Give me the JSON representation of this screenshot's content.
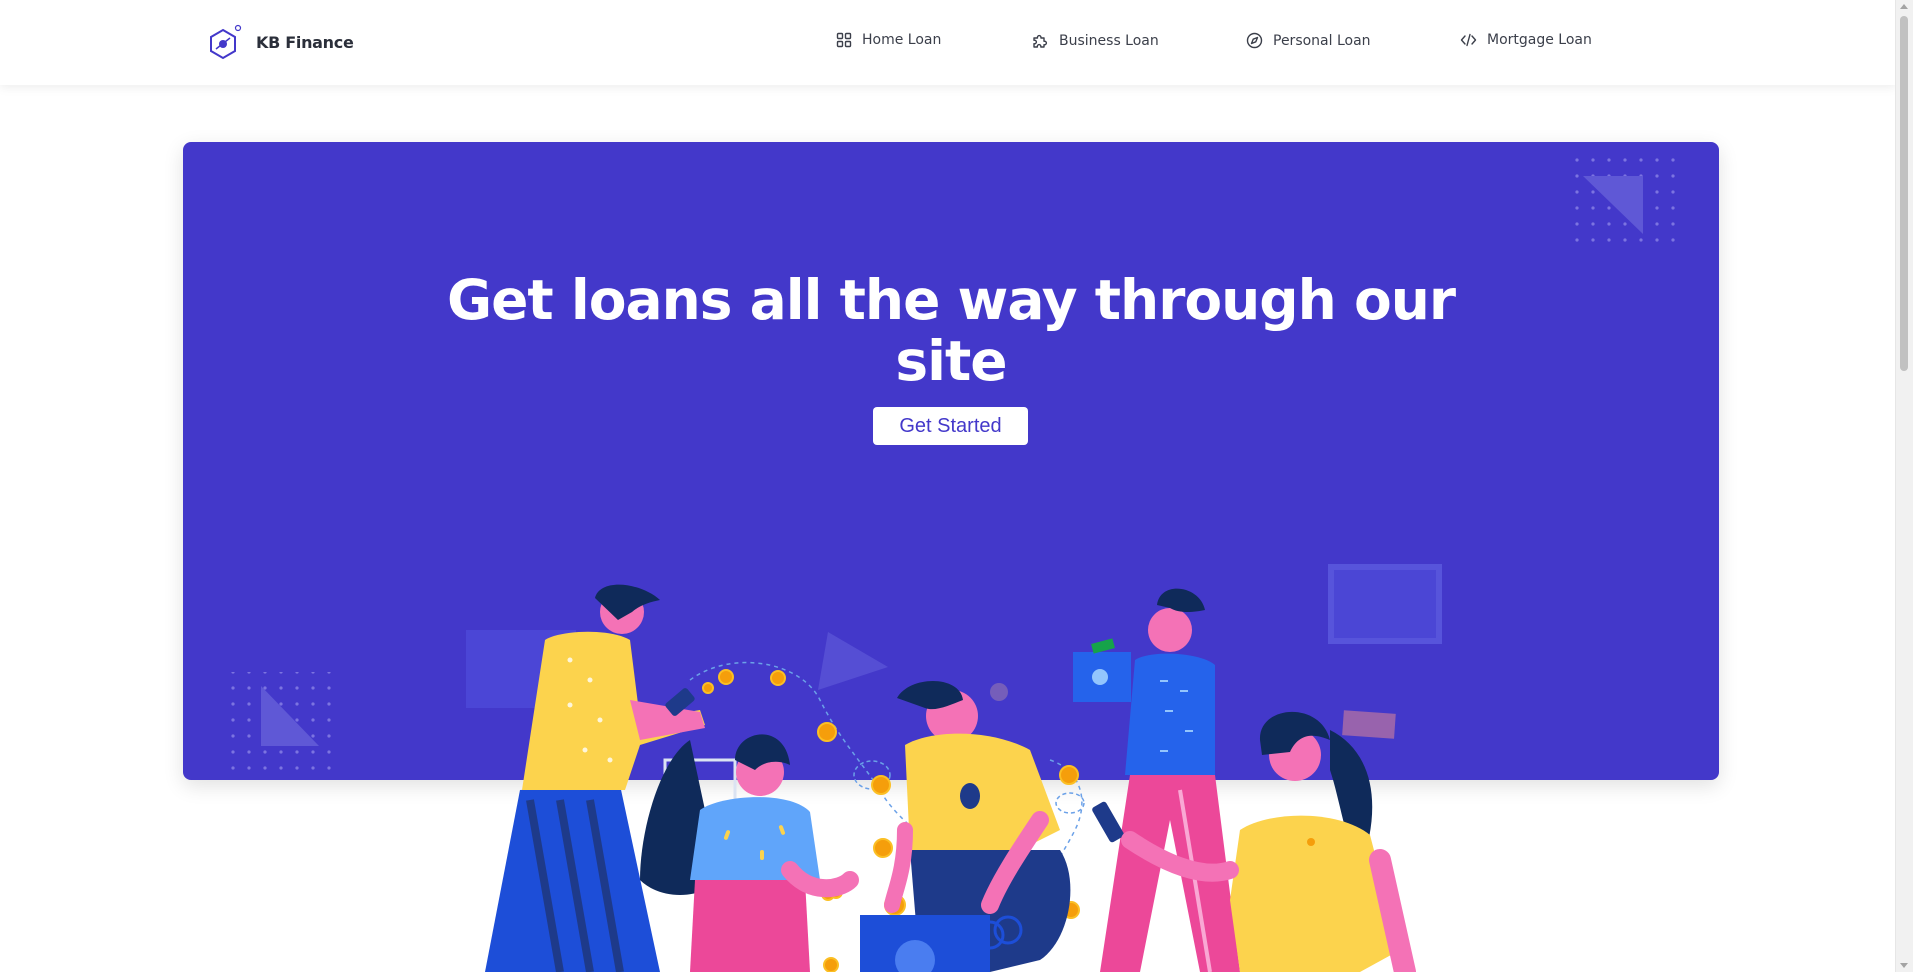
{
  "brand": {
    "name": "KB Finance"
  },
  "nav": {
    "items": [
      {
        "label": "Home Loan",
        "icon": "grid-icon"
      },
      {
        "label": "Business Loan",
        "icon": "puzzle-icon"
      },
      {
        "label": "Personal Loan",
        "icon": "compass-icon"
      },
      {
        "label": "Mortgage Loan",
        "icon": "code-icon"
      }
    ]
  },
  "hero": {
    "title_line1": "Get loans all the way through our",
    "title_line2": "site",
    "cta_label": "Get Started"
  },
  "colors": {
    "accent": "#4338ca",
    "navbar_bg": "#ffffff",
    "coin": "#f59e0b",
    "shirt_yellow": "#fcd34d",
    "pants_navy": "#1e3a8a",
    "pink": "#ec4899"
  }
}
